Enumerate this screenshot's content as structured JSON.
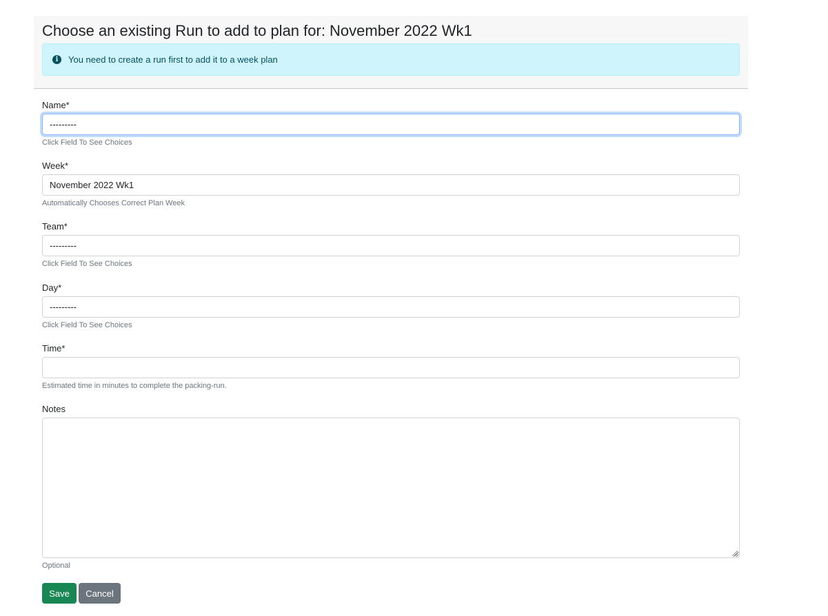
{
  "header": {
    "title": "Choose an existing Run to add to plan for: November 2022 Wk1",
    "alert": {
      "icon": "info-circle-icon",
      "text": "You need to create a run first to add it to a week plan"
    }
  },
  "form": {
    "name": {
      "label": "Name*",
      "value": "---------",
      "help": "Click Field To See Choices"
    },
    "week": {
      "label": "Week*",
      "value": "November 2022 Wk1",
      "help": "Automatically Chooses Correct Plan Week"
    },
    "team": {
      "label": "Team*",
      "value": "---------",
      "help": "Click Field To See Choices"
    },
    "day": {
      "label": "Day*",
      "value": "---------",
      "help": "Click Field To See Choices"
    },
    "time": {
      "label": "Time*",
      "value": "",
      "help": "Estimated time in minutes to complete the packing-run."
    },
    "notes": {
      "label": "Notes",
      "value": "",
      "help": "Optional"
    }
  },
  "actions": {
    "save_label": "Save",
    "cancel_label": "Cancel"
  },
  "colors": {
    "alert_bg": "#cff4fc",
    "alert_text": "#055160",
    "save": "#198754",
    "cancel": "#6c757d",
    "focus_border": "#86b7fe"
  }
}
